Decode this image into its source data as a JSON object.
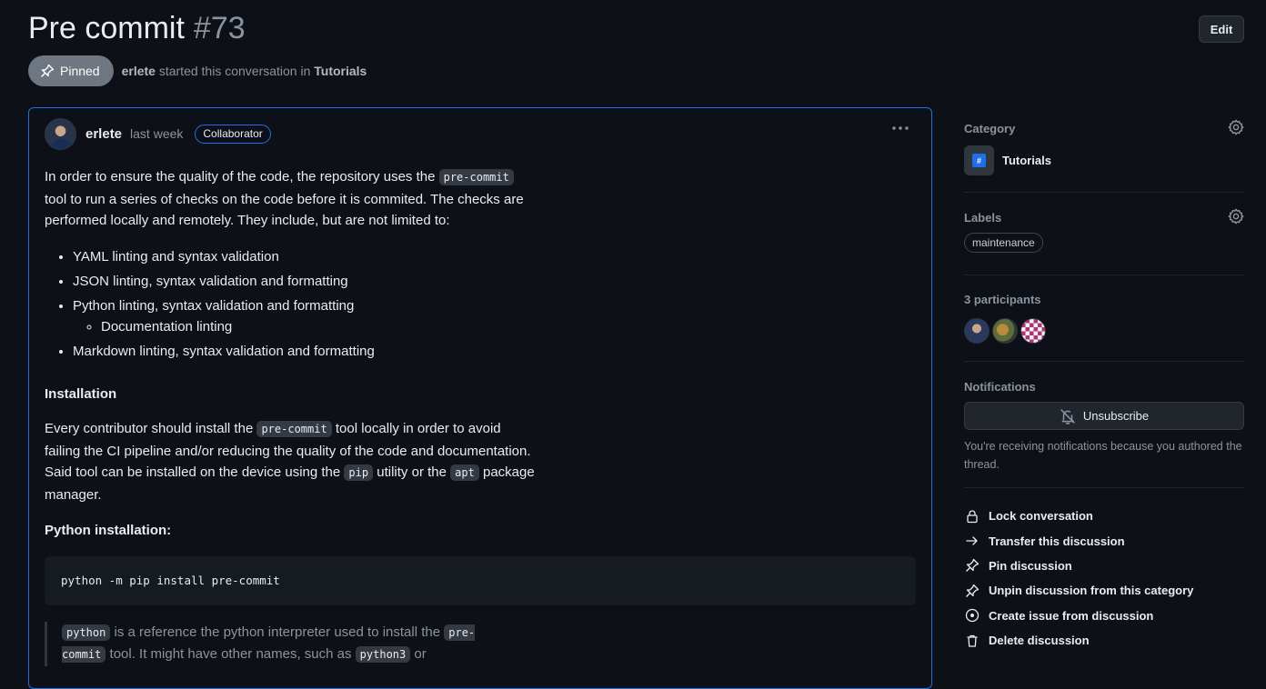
{
  "header": {
    "title": "Pre commit",
    "number": "#73",
    "edit_label": "Edit",
    "pinned_label": "Pinned",
    "author": "erlete",
    "started_text": "started this conversation in",
    "category": "Tutorials"
  },
  "post": {
    "author": "erlete",
    "time": "last week",
    "role": "Collaborator",
    "more_label": "···",
    "intro": {
      "t1": "In order to ensure the quality of the code, the repository uses the ",
      "code1": "pre-commit",
      "t2": " tool to run a series of checks on the code before it is commited. The checks are performed locally and remotely. They include, but are not limited to:"
    },
    "checks": [
      "YAML linting and syntax validation",
      "JSON linting, syntax validation and formatting",
      "Python linting, syntax validation and formatting",
      "Markdown linting, syntax validation and formatting"
    ],
    "sub_checks": [
      "Documentation linting"
    ],
    "installation_heading": "Installation",
    "install": {
      "t1": "Every contributor should install the ",
      "code1": "pre-commit",
      "t2": " tool locally in order to avoid failing the CI pipeline and/or reducing the quality of the code and documentation. Said tool can be installed on the device using the ",
      "code2": "pip",
      "t3": " utility or the ",
      "code3": "apt",
      "t4": " package manager."
    },
    "python_heading": "Python installation:",
    "python_command": "python -m pip install pre-commit",
    "quote": {
      "code1": "python",
      "t1": " is a reference the python interpreter used to install the ",
      "code2": "pre-commit",
      "t2": " tool. It might have other names, such as ",
      "code3": "python3",
      "t3": " or"
    }
  },
  "sidebar": {
    "category_label": "Category",
    "category_name": "Tutorials",
    "category_icon": "#",
    "labels_label": "Labels",
    "labels": [
      "maintenance"
    ],
    "participants_label": "3 participants",
    "notifications_label": "Notifications",
    "unsubscribe_label": "Unsubscribe",
    "notification_note": "You're receiving notifications because you authored the thread.",
    "actions": [
      {
        "label": "Lock conversation",
        "icon": "lock-icon"
      },
      {
        "label": "Transfer this discussion",
        "icon": "arrow-right-icon"
      },
      {
        "label": "Pin discussion",
        "icon": "pin-icon"
      },
      {
        "label": "Unpin discussion from this category",
        "icon": "pin-icon"
      },
      {
        "label": "Create issue from discussion",
        "icon": "issue-opened-icon"
      },
      {
        "label": "Delete discussion",
        "icon": "trash-icon"
      }
    ]
  }
}
